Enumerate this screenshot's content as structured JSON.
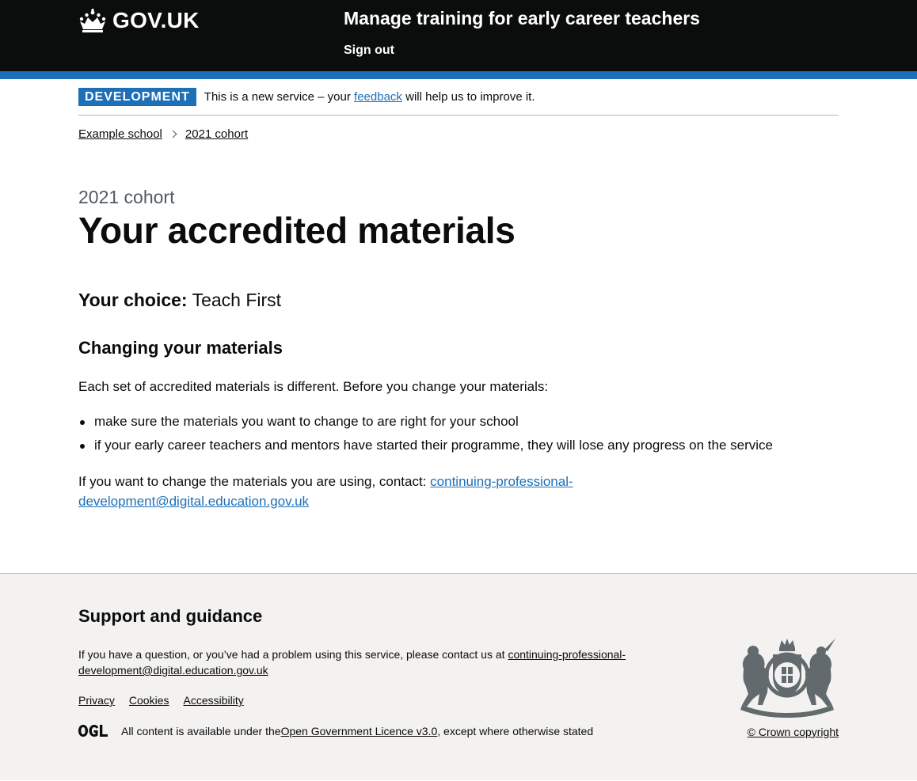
{
  "header": {
    "logo_text": "GOV.UK",
    "service_name": "Manage training for early career teachers",
    "sign_out_label": "Sign out"
  },
  "phase_banner": {
    "tag": "DEVELOPMENT",
    "text_before": "This is a new service – your ",
    "link_text": "feedback",
    "text_after": " will help us to improve it."
  },
  "breadcrumbs": [
    {
      "label": "Example school"
    },
    {
      "label": "2021 cohort"
    }
  ],
  "main": {
    "caption": "2021 cohort",
    "title": "Your accredited materials",
    "choice_label": "Your choice:",
    "choice_value": "Teach First",
    "section_heading": "Changing your materials",
    "intro": "Each set of accredited materials is different. Before you change your materials:",
    "bullets": [
      "make sure the materials you want to change to are right for your school",
      "if your early career teachers and mentors have started their programme, they will lose any progress on the service"
    ],
    "contact_text": "If you want to change the materials you are using, contact: ",
    "contact_email": "continuing-professional-development@digital.education.gov.uk"
  },
  "footer": {
    "heading": "Support and guidance",
    "help_text": "If you have a question, or you’ve had a problem using this service, please contact us at ",
    "help_email": "continuing-professional-development@digital.education.gov.uk",
    "links": [
      {
        "label": "Privacy"
      },
      {
        "label": "Cookies"
      },
      {
        "label": "Accessibility"
      }
    ],
    "licence_before": "All content is available under the ",
    "licence_link": "Open Government Licence v3.0",
    "licence_after": ", except where otherwise stated",
    "copyright": "© Crown copyright"
  },
  "colors": {
    "header_bg": "#0b0c0c",
    "brand_blue": "#1d70b8",
    "footer_bg": "#f3f2f1",
    "link": "#1d70b8"
  },
  "icons": [
    "crown-icon",
    "chevron-right-icon",
    "ogl-logo-icon",
    "royal-crest-icon"
  ]
}
